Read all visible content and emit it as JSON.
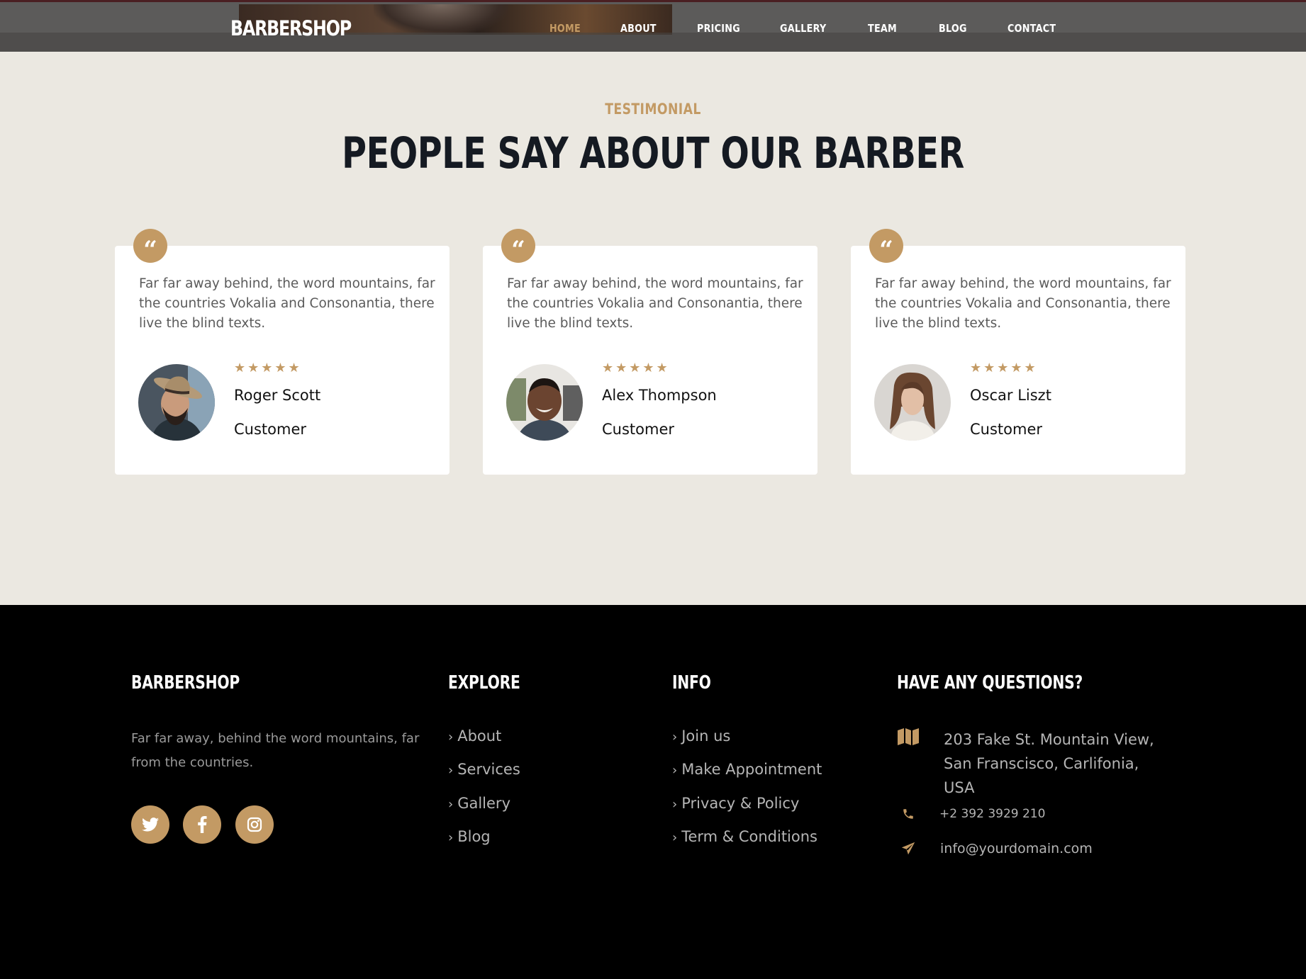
{
  "nav": {
    "brand": "BARBERSHOP",
    "items": [
      {
        "label": "HOME",
        "active": true
      },
      {
        "label": "ABOUT",
        "active": false
      },
      {
        "label": "PRICING",
        "active": false
      },
      {
        "label": "GALLERY",
        "active": false
      },
      {
        "label": "TEAM",
        "active": false
      },
      {
        "label": "BLOG",
        "active": false
      },
      {
        "label": "CONTACT",
        "active": false
      }
    ]
  },
  "testimonial": {
    "kicker": "TESTIMONIAL",
    "title": "PEOPLE SAY ABOUT OUR BARBER",
    "cards": [
      {
        "quote_icon": "quote-icon",
        "text": "Far far away behind, the word mountains, far the countries Vokalia and Consonantia, there live the blind texts.",
        "rating": 5,
        "stars": "★★★★★",
        "name": "Roger Scott",
        "role": "Customer",
        "avatar": "man-with-hat-avatar"
      },
      {
        "quote_icon": "quote-icon",
        "text": "Far far away behind, the word mountains, far the countries Vokalia and Consonantia, there live the blind texts.",
        "rating": 5,
        "stars": "★★★★★",
        "name": "Alex Thompson",
        "role": "Customer",
        "avatar": "smiling-man-avatar"
      },
      {
        "quote_icon": "quote-icon",
        "text": "Far far away behind, the word mountains, far the countries Vokalia and Consonantia, there live the blind texts.",
        "rating": 5,
        "stars": "★★★★★",
        "name": "Oscar Liszt",
        "role": "Customer",
        "avatar": "long-hair-man-avatar"
      }
    ]
  },
  "footer": {
    "brand_heading": "BARBERSHOP",
    "about_text": "Far far away, behind the word mountains, far from the countries.",
    "social": [
      {
        "name": "twitter-icon"
      },
      {
        "name": "facebook-icon"
      },
      {
        "name": "instagram-icon"
      }
    ],
    "explore_heading": "EXPLORE",
    "explore_links": [
      "About",
      "Services",
      "Gallery",
      "Blog"
    ],
    "info_heading": "INFO",
    "info_links": [
      "Join us",
      "Make Appointment",
      "Privacy & Policy",
      "Term & Conditions"
    ],
    "questions_heading": "HAVE ANY QUESTIONS?",
    "address_line1": "203 Fake St. Mountain View,",
    "address_line2": "San Franscisco, Carlifonia,",
    "address_line3": "USA",
    "phone": "+2 392 3929 210",
    "email": "info@yourdomain.com"
  },
  "colors": {
    "accent": "#c39a64",
    "section_bg": "#ebe8e1",
    "heading": "#151a22",
    "footer_bg": "#000000"
  }
}
